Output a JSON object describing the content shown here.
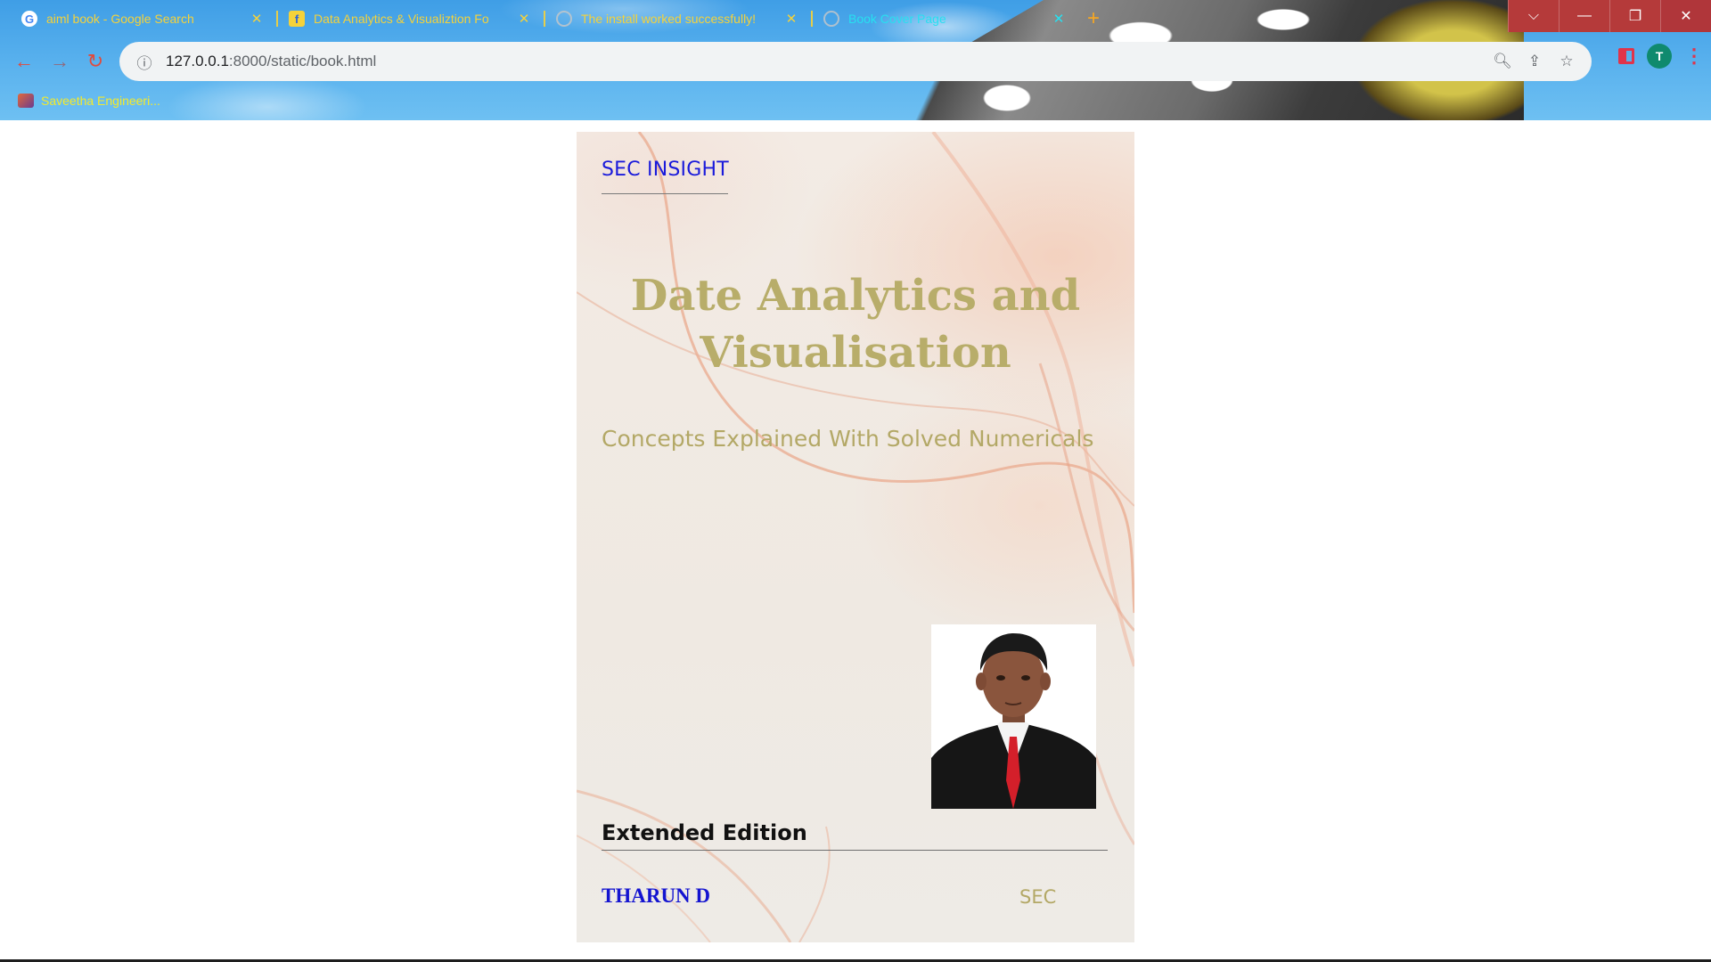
{
  "browser": {
    "tabs": [
      {
        "title": "aiml book - Google Search",
        "favicon": "google-g-icon",
        "active": false
      },
      {
        "title": "Data Analytics & Visualiztion Fo",
        "favicon": "flipkart-icon",
        "active": false
      },
      {
        "title": "The install worked successfully!",
        "favicon": "globe-icon",
        "active": false
      },
      {
        "title": "Book Cover Page",
        "favicon": "globe-icon",
        "active": true
      }
    ],
    "new_tab_label": "+",
    "address": {
      "host": "127.0.0.1",
      "path": ":8000/static/book.html"
    },
    "profile_initial": "T",
    "bookmarks": [
      {
        "label": "Saveetha Engineeri..."
      }
    ],
    "colors": {
      "tab_text": "#f5d23a",
      "active_tab_text": "#27e0f0",
      "accent": "#e0344a"
    }
  },
  "cover": {
    "publisher": "SEC INSIGHT",
    "title_line1": "Date Analytics and",
    "title_line2": "Visualisation",
    "subtitle": "Concepts Explained With Solved Numericals",
    "edition": "Extended Edition",
    "author": "THARUN D",
    "organization": "SEC",
    "colors": {
      "publisher": "#1a1adb",
      "title": "#b8ad6a",
      "author": "#1414d0"
    }
  }
}
